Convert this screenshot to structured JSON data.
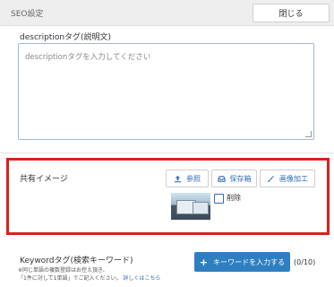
{
  "header": {
    "title": "SEO設定",
    "close_label": "閉じる"
  },
  "description": {
    "label": "descriptionタグ(説明文)",
    "placeholder": "descriptionタグを入力してください"
  },
  "share_image": {
    "label": "共有イメージ",
    "buttons": {
      "browse": "参照",
      "saved": "保存箱",
      "edit": "画像加工"
    },
    "delete_label": "削除"
  },
  "keyword": {
    "label": "Keywordタグ(検索キーワード)",
    "note_line1": "※同じ単語の複数登録はお控え頂き、",
    "note_line2": "「1件に対して1単語」でご記入ください。",
    "note_link": "詳しくはこちら",
    "add_button": "キーワードを入力する",
    "count": "(0/10)"
  },
  "colors": {
    "accent": "#2e7fc2",
    "highlight": "#d9201c"
  },
  "icons": {
    "browse": "upload-icon",
    "saved": "tray-icon",
    "edit": "brush-icon",
    "add": "plus-icon"
  }
}
